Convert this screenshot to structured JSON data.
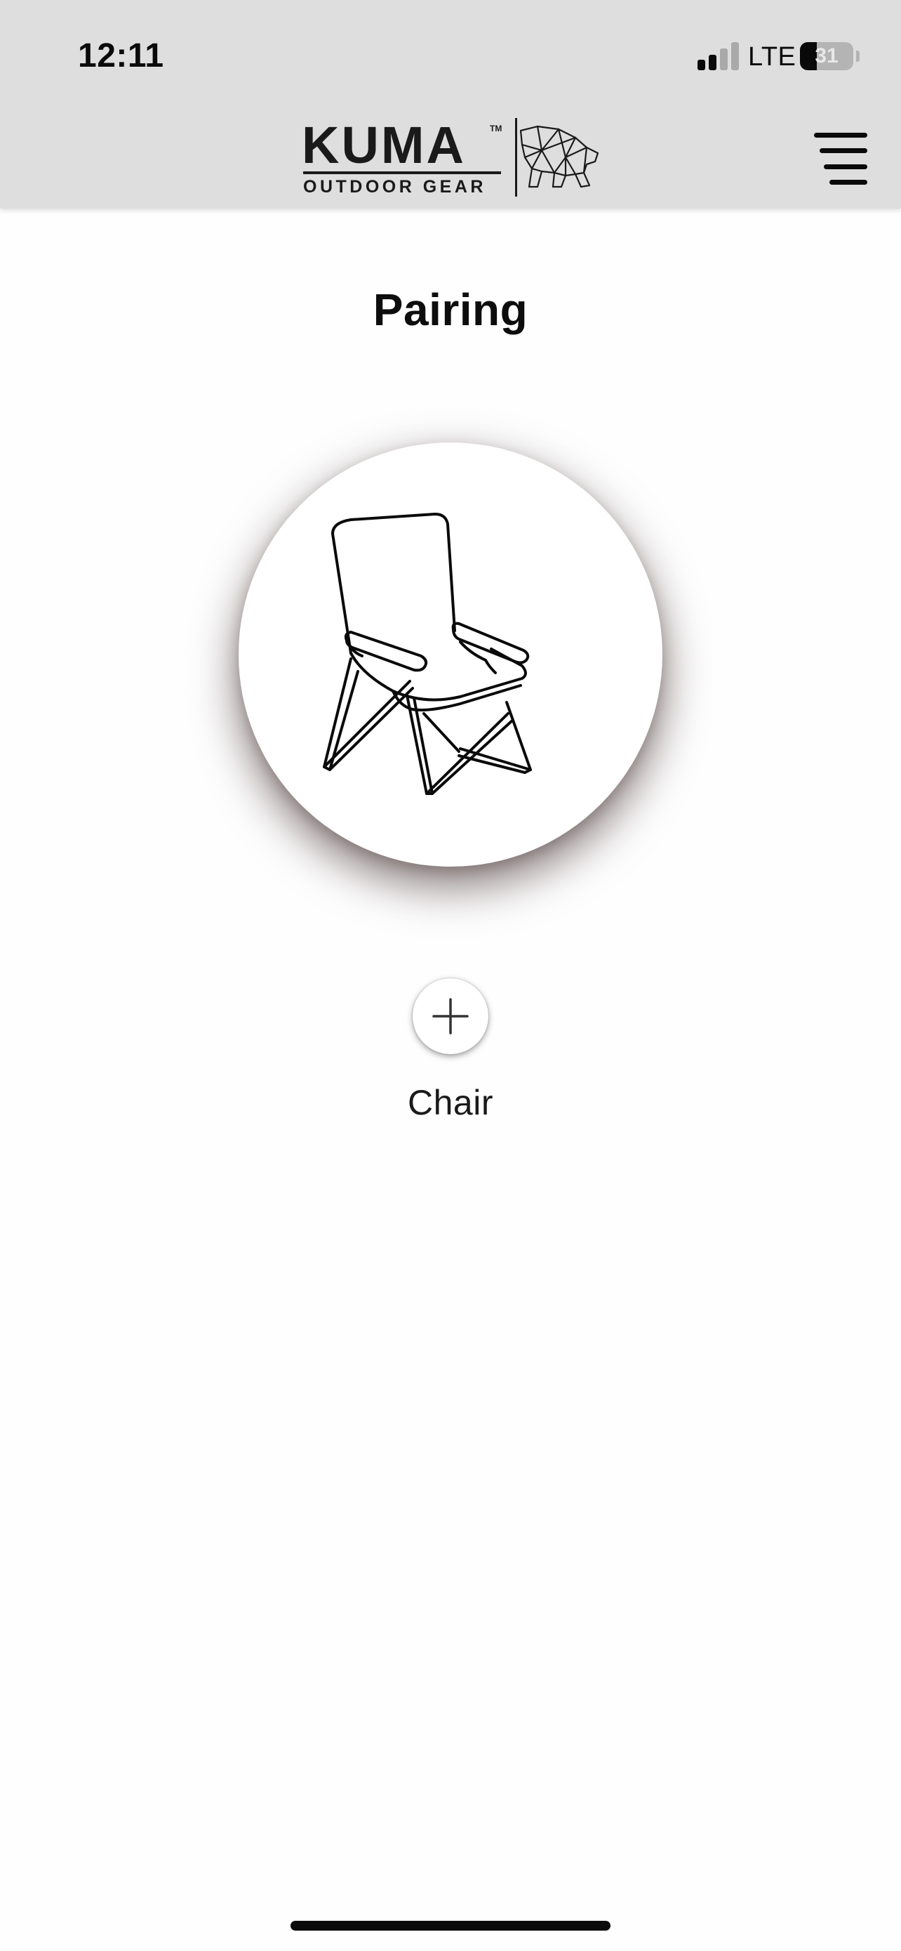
{
  "status_bar": {
    "time": "12:11",
    "network": "LTE",
    "battery_percent": "31",
    "battery_level": 0.31,
    "signal_bars_active": 2,
    "signal_bars_total": 4
  },
  "header": {
    "logo": {
      "brand": "KUMA",
      "tagline": "OUTDOOR GEAR",
      "trademark": "TM",
      "icon": "bear-icon"
    },
    "menu_icon": "hamburger-menu-icon"
  },
  "main": {
    "title": "Pairing",
    "device_image_icon": "folding-chair-icon",
    "add_button_icon": "plus-icon",
    "device_label": "Chair"
  },
  "colors": {
    "header_background": "#dedede",
    "page_background": "#fefefe",
    "text": "#111111"
  }
}
